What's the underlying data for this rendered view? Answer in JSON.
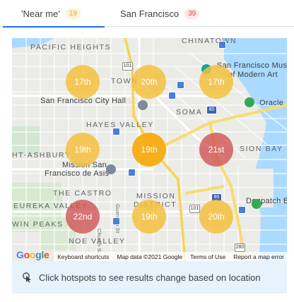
{
  "tabs": [
    {
      "label": "'Near me'",
      "count": "19",
      "active": true
    },
    {
      "label": "San Francisco",
      "count": "39",
      "active": false
    }
  ],
  "map": {
    "labels": {
      "chinatown": "CHINATOWN",
      "pacific_heights": "PACIFIC HEIGHTS",
      "downtown_partial": "TOWN",
      "museum_line1": "San Francisco Museum",
      "museum_line2": "of Modern Art",
      "city_hall": "San Francisco City Hall",
      "soma": "SOMA",
      "oracle": "Oracle",
      "hayes_valley": "HAYES VALLEY",
      "haight_ashbury": "HT-ASHBURY",
      "mission_bay": "SION BAY",
      "mission_line1": "Mission San",
      "mission_line2": "Francisco de Asis",
      "the_castro": "THE CASTRO",
      "mission_district_line1": "MISSION",
      "mission_district_line2": "DISTRICT",
      "eureka_valley": "EUREKA VALLEY",
      "dogpatch": "Dogpatch B",
      "twin_peaks": "WIN PEAKS",
      "noe_valley": "NOE VALLEY",
      "street_church": "Church St",
      "street_guerrero": "Guerrero St"
    },
    "highways": [
      "101",
      "80",
      "101",
      "280",
      "80"
    ],
    "hotspots": [
      {
        "label": "17th",
        "tone": "light"
      },
      {
        "label": "20th",
        "tone": "light"
      },
      {
        "label": "17th",
        "tone": "light"
      },
      {
        "label": "19th",
        "tone": "light"
      },
      {
        "label": "19th",
        "tone": "orange"
      },
      {
        "label": "21st",
        "tone": "red"
      },
      {
        "label": "22nd",
        "tone": "red"
      },
      {
        "label": "19th",
        "tone": "light"
      },
      {
        "label": "20th",
        "tone": "light"
      }
    ],
    "attribution": {
      "logo": "Google",
      "keyboard_shortcuts": "Keyboard shortcuts",
      "map_data": "Map data ©2021 Google",
      "terms": "Terms of Use",
      "report": "Report a map error"
    }
  },
  "info": {
    "icon": "tap-cursor-icon",
    "text": "Click hotspots to see results change based on location"
  },
  "colors": {
    "accent": "#1a73e8",
    "hotspot_light": "#f5c13d",
    "hotspot_orange": "#f8ab12",
    "hotspot_red": "#ce5050",
    "info_bg": "#e8f2fc"
  }
}
